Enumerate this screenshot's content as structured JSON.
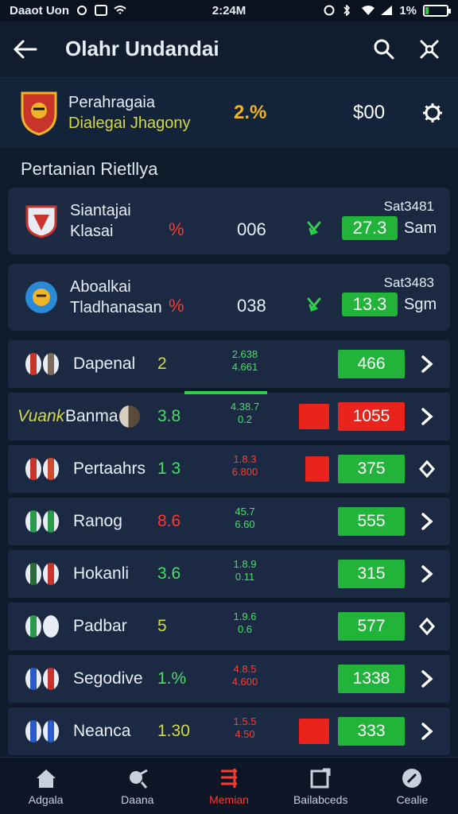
{
  "status": {
    "carrier": "Daaot Uon",
    "time": "2:24M",
    "battery": "1%",
    "battery_level": 0.15
  },
  "header": {
    "title": "Olahr Undandai"
  },
  "summary": {
    "line1": "Perahragaia",
    "line2": "Dialegai Jhagony",
    "percent": "2.%",
    "amount": "$00"
  },
  "section": {
    "title": "Pertanian Rietllya"
  },
  "featured": [
    {
      "name1": "Siantajai",
      "name2": "Klasai",
      "pct": "%",
      "mid": "006",
      "code": "Sat3481",
      "value": "27.3",
      "unit": "Sam"
    },
    {
      "name1": "Aboalkai",
      "name2": "Tladhanasan",
      "pct": "%",
      "mid": "038",
      "code": "Sat3483",
      "value": "13.3",
      "unit": "Sgm"
    }
  ],
  "matches": [
    {
      "team": "Dapenal",
      "score": "2",
      "odd1": "2.638",
      "odd2": "4.661",
      "value": "466",
      "has_red": false,
      "red_wide": false,
      "score_color": "#d4d84a",
      "odds_color": "#4ade6a",
      "flags": [
        "#c8342c",
        "#7a6a5a"
      ],
      "chev": "right"
    },
    {
      "team": "Banma",
      "prefix": "Vuank",
      "score": "3.8",
      "odd1": "4.38.7",
      "odd2": "0.2",
      "value": "1055",
      "has_red": true,
      "red_wide": false,
      "value_red": true,
      "score_color": "#4ade6a",
      "odds_color": "#4ade6a",
      "flags": [
        "#8a7a6a"
      ],
      "chev": "right"
    },
    {
      "team": "Pertaahrs",
      "score": "1 3",
      "odd1": "1.8.3",
      "odd2": "6.800",
      "value": "375",
      "has_red": true,
      "red_small": true,
      "score_color": "#4ade6a",
      "odds_color": "#ff3b30",
      "flags": [
        "#c8342c",
        "#d24a2c"
      ],
      "chev": "diamond"
    },
    {
      "team": "Ranog",
      "score": "8.6",
      "odd1": "45.7",
      "odd2": "6.60",
      "value": "555",
      "has_red": false,
      "score_color": "#ff3b30",
      "odds_color": "#4ade6a",
      "flags": [
        "#2a9a4a",
        "#2a9a4a"
      ],
      "chev": "right"
    },
    {
      "team": "Hokanli",
      "score": "3.6",
      "odd1": "1.8.9",
      "odd2": "0.11",
      "value": "315",
      "has_red": false,
      "score_color": "#4ade6a",
      "odds_color": "#4ade6a",
      "flags": [
        "#2a6a3a",
        "#c8342c"
      ],
      "chev": "right"
    },
    {
      "team": "Padbar",
      "score": "5",
      "odd1": "1.9.6",
      "odd2": "0.6",
      "value": "577",
      "has_red": false,
      "score_color": "#d4d84a",
      "odds_color": "#4ade6a",
      "flags": [
        "#2a9a4a",
        "#e8edf5"
      ],
      "chev": "diamond"
    },
    {
      "team": "Segodive",
      "score": "1.%",
      "odd1": "4.8.5",
      "odd2": "4.600",
      "value": "1338",
      "has_red": false,
      "score_color": "#4ade6a",
      "odds_color": "#ff3b30",
      "flags": [
        "#2a5ac8",
        "#c8342c"
      ],
      "chev": "right"
    },
    {
      "team": "Neanca",
      "score": "1.30",
      "odd1": "1.5.5",
      "odd2": "4.50",
      "value": "333",
      "has_red": true,
      "score_color": "#d4d84a",
      "odds_color": "#ff3b30",
      "flags": [
        "#2a5ac8",
        "#2a5ac8"
      ],
      "chev": "right"
    }
  ],
  "nav": [
    {
      "label": "Adgala",
      "icon": "home-icon",
      "active": false
    },
    {
      "label": "Daana",
      "icon": "whistle-icon",
      "active": false
    },
    {
      "label": "Memian",
      "icon": "list-icon",
      "active": true
    },
    {
      "label": "Bailabceds",
      "icon": "note-icon",
      "active": false
    },
    {
      "label": "Cealie",
      "icon": "ball-icon",
      "active": false
    }
  ],
  "colors": {
    "bg": "#0f1a2b",
    "card": "#1b2a42",
    "green": "#22b33a",
    "red": "#e8241c",
    "accent_yellow": "#d4d84a"
  }
}
